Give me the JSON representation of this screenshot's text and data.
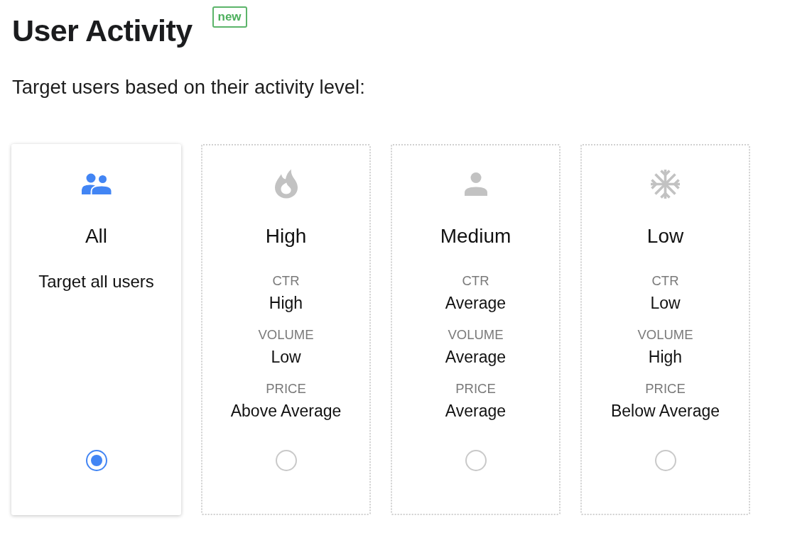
{
  "title": "User Activity",
  "badge": "new",
  "subtitle": "Target users based on their activity level:",
  "options": [
    {
      "kind": "description",
      "label": "All",
      "description": "Target all users",
      "selected": true
    },
    {
      "kind": "metrics",
      "label": "High",
      "stats": [
        {
          "label": "CTR",
          "value": "High"
        },
        {
          "label": "VOLUME",
          "value": "Low"
        },
        {
          "label": "PRICE",
          "value": "Above Average"
        }
      ],
      "selected": false
    },
    {
      "kind": "metrics",
      "label": "Medium",
      "stats": [
        {
          "label": "CTR",
          "value": "Average"
        },
        {
          "label": "VOLUME",
          "value": "Average"
        },
        {
          "label": "PRICE",
          "value": "Average"
        }
      ],
      "selected": false
    },
    {
      "kind": "metrics",
      "label": "Low",
      "stats": [
        {
          "label": "CTR",
          "value": "Low"
        },
        {
          "label": "VOLUME",
          "value": "High"
        },
        {
          "label": "PRICE",
          "value": "Below Average"
        }
      ],
      "selected": false
    }
  ]
}
